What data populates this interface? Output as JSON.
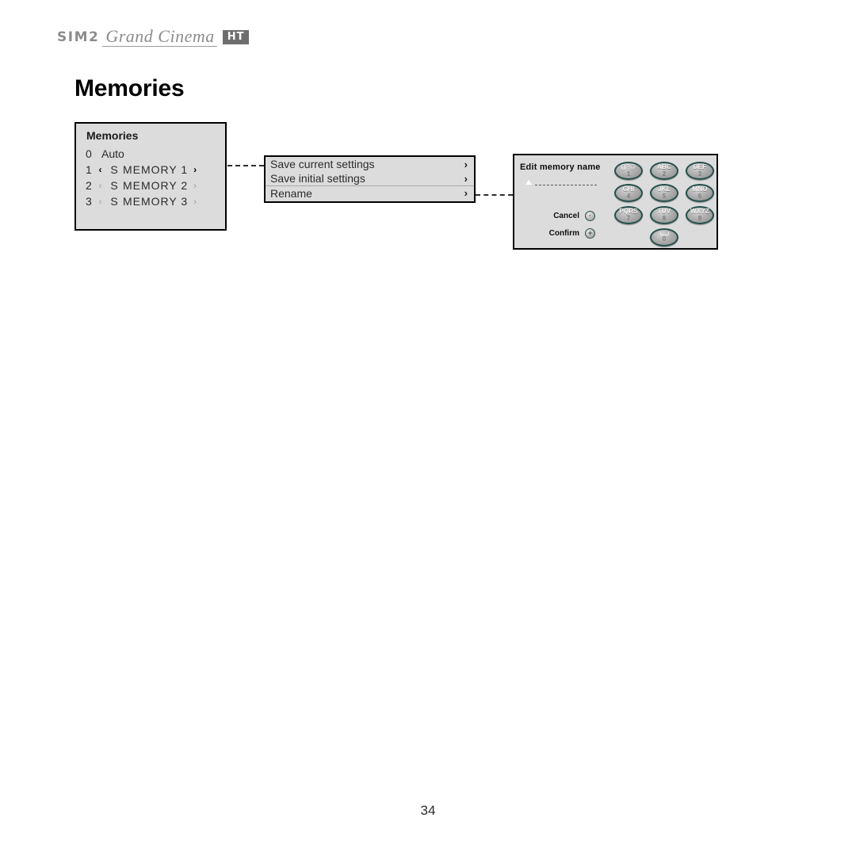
{
  "brand": {
    "sim2": "SIM2",
    "product": "Grand Cinema",
    "badge": "HT",
    "logo_color": "#8c8c8c",
    "badge_bg": "#6e6e6e"
  },
  "page": {
    "title": "Memories",
    "number": "34",
    "panel_bg": "#dcdcdc",
    "panel_border": "#000000"
  },
  "memories_panel": {
    "heading": "Memories",
    "rows": [
      {
        "index": "0",
        "left_arrow": "",
        "slot": "",
        "name": "Auto",
        "right_arrow": "",
        "selected": false
      },
      {
        "index": "1",
        "left_arrow": "‹",
        "slot": "S",
        "name": "MEMORY 1",
        "right_arrow": "›",
        "selected": true
      },
      {
        "index": "2",
        "left_arrow": "‹",
        "slot": "S",
        "name": "MEMORY 2",
        "right_arrow": "›",
        "selected": false
      },
      {
        "index": "3",
        "left_arrow": "‹",
        "slot": "S",
        "name": "MEMORY 3",
        "right_arrow": "›",
        "selected": false
      }
    ]
  },
  "save_menu_panel": {
    "items": [
      {
        "label": "Save current settings",
        "chevron": "›"
      },
      {
        "label": "Save initial settings",
        "chevron": "›"
      },
      {
        "label": "Rename",
        "chevron": "›"
      }
    ]
  },
  "keypad_panel": {
    "title": "Edit memory name",
    "entry_value": "",
    "entry_placeholder": "- - - - - - - - - -",
    "cancel_label": "Cancel",
    "confirm_label": "Confirm",
    "cancel_glyph": "·",
    "confirm_glyph": "+",
    "keys": [
      {
        "letters": "()?@",
        "digit": "1"
      },
      {
        "letters": "ABC",
        "digit": "2"
      },
      {
        "letters": "DEF",
        "digit": "3"
      },
      {
        "letters": "GHI",
        "digit": "4"
      },
      {
        "letters": "JKL",
        "digit": "5"
      },
      {
        "letters": "MNO",
        "digit": "6"
      },
      {
        "letters": "PQRS",
        "digit": "7"
      },
      {
        "letters": "TUV",
        "digit": "8"
      },
      {
        "letters": "WXYZ",
        "digit": "9"
      }
    ],
    "space_key": {
      "letters": "space-bar",
      "digit": "0"
    },
    "key_outline_color": "#24504c"
  }
}
